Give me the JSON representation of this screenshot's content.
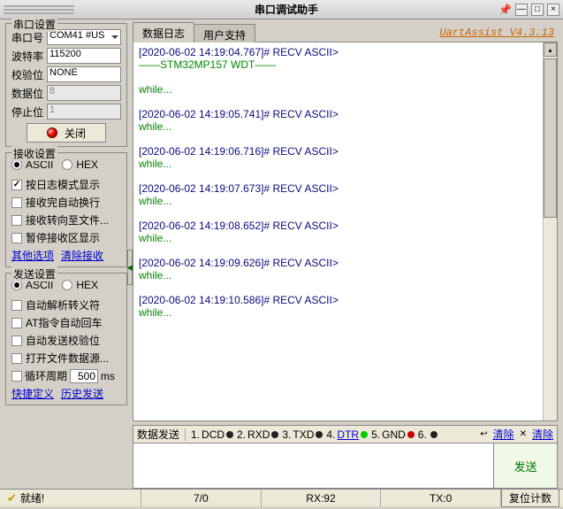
{
  "title": "串口调试助手",
  "version": "UartAssist V4.3.13",
  "port": {
    "group": "串口设置",
    "labels": {
      "port": "串口号",
      "baud": "波特率",
      "parity": "校验位",
      "databits": "数据位",
      "stopbits": "停止位"
    },
    "values": {
      "port": "COM41 #US",
      "baud": "115200",
      "parity": "NONE",
      "databits": "8",
      "stopbits": "1"
    },
    "close_btn": "关闭"
  },
  "recv": {
    "group": "接收设置",
    "mode": {
      "ascii": "ASCII",
      "hex": "HEX",
      "selected": "ascii"
    },
    "checks": [
      {
        "label": "按日志模式显示",
        "checked": true
      },
      {
        "label": "接收完自动换行",
        "checked": false
      },
      {
        "label": "接收转向至文件...",
        "checked": false
      },
      {
        "label": "暂停接收区显示",
        "checked": false
      }
    ],
    "links": {
      "other": "其他选项",
      "clear": "清除接收"
    }
  },
  "send": {
    "group": "发送设置",
    "mode": {
      "ascii": "ASCII",
      "hex": "HEX",
      "selected": "ascii"
    },
    "checks": [
      {
        "label": "自动解析转义符",
        "checked": false
      },
      {
        "label": "AT指令自动回车",
        "checked": false
      },
      {
        "label": "自动发送校验位",
        "checked": false
      },
      {
        "label": "打开文件数据源...",
        "checked": false
      }
    ],
    "cycle": {
      "label": "循环周期",
      "value": "500",
      "unit": "ms",
      "checked": false
    },
    "links": {
      "quick": "快捷定义",
      "history": "历史发送"
    }
  },
  "tabs": {
    "log": "数据日志",
    "support": "用户支持",
    "active": "log"
  },
  "log": [
    {
      "t": "blue",
      "v": "[2020-06-02 14:19:04.767]# RECV ASCII>"
    },
    {
      "t": "green",
      "v": "——STM32MP157 WDT——"
    },
    {
      "t": "blank",
      "v": ""
    },
    {
      "t": "green",
      "v": "while..."
    },
    {
      "t": "blank",
      "v": ""
    },
    {
      "t": "blue",
      "v": "[2020-06-02 14:19:05.741]# RECV ASCII>"
    },
    {
      "t": "green",
      "v": "while..."
    },
    {
      "t": "blank",
      "v": ""
    },
    {
      "t": "blue",
      "v": "[2020-06-02 14:19:06.716]# RECV ASCII>"
    },
    {
      "t": "green",
      "v": "while..."
    },
    {
      "t": "blank",
      "v": ""
    },
    {
      "t": "blue",
      "v": "[2020-06-02 14:19:07.673]# RECV ASCII>"
    },
    {
      "t": "green",
      "v": "while..."
    },
    {
      "t": "blank",
      "v": ""
    },
    {
      "t": "blue",
      "v": "[2020-06-02 14:19:08.652]# RECV ASCII>"
    },
    {
      "t": "green",
      "v": "while..."
    },
    {
      "t": "blank",
      "v": ""
    },
    {
      "t": "blue",
      "v": "[2020-06-02 14:19:09.626]# RECV ASCII>"
    },
    {
      "t": "green",
      "v": "while..."
    },
    {
      "t": "blank",
      "v": ""
    },
    {
      "t": "blue",
      "v": "[2020-06-02 14:19:10.586]# RECV ASCII>"
    },
    {
      "t": "green",
      "v": "while..."
    }
  ],
  "sendbar": {
    "label": "数据发送",
    "signals": [
      {
        "n": "1",
        "name": "DCD",
        "state": "off",
        "ul": false
      },
      {
        "n": "2",
        "name": "RXD",
        "state": "off",
        "ul": false
      },
      {
        "n": "3",
        "name": "TXD",
        "state": "off",
        "ul": false
      },
      {
        "n": "4",
        "name": "DTR",
        "state": "green",
        "ul": true
      },
      {
        "n": "5",
        "name": "GND",
        "state": "red",
        "ul": false
      },
      {
        "n": "6",
        "name": "",
        "state": "off",
        "ul": false
      }
    ],
    "clear1": "清除",
    "clear2": "清除",
    "send_btn": "发送"
  },
  "status": {
    "ready": "就绪!",
    "c1": "7/0",
    "c2": "RX:92",
    "c3": "TX:0",
    "reset": "复位计数"
  }
}
